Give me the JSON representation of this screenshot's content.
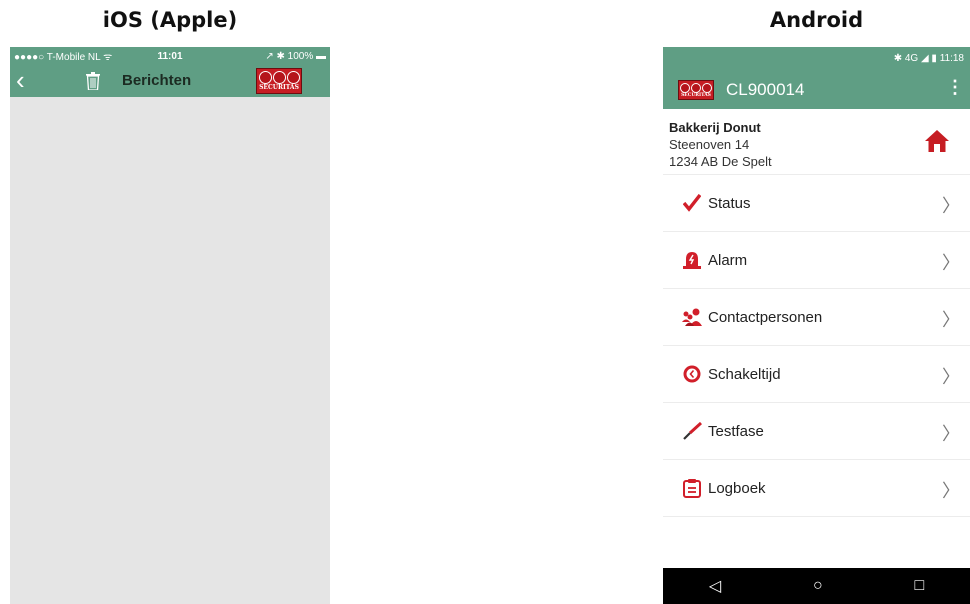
{
  "headings": {
    "ios": "iOS (Apple)",
    "android": "Android"
  },
  "ios": {
    "status": {
      "carrier": "●●●●○ T-Mobile NL ᯤ",
      "time": "11:01",
      "right": "↗ ✱ 100% ▬"
    },
    "nav": {
      "back": "‹",
      "title": "Berichten"
    },
    "logo_text": "SECURITAS"
  },
  "android": {
    "status": "✱ 4G ◢ ▮ 11:18",
    "toolbar": {
      "title": "CL900014",
      "menu": "⋮"
    },
    "logo_text": "SECURITAS",
    "address": {
      "name": "Bakkerij Donut",
      "street": "Steenoven 14",
      "city": "1234 AB De Spelt"
    },
    "menu": [
      {
        "label": "Status",
        "icon": "check-icon"
      },
      {
        "label": "Alarm",
        "icon": "alarm-icon"
      },
      {
        "label": "Contactpersonen",
        "icon": "contacts-icon"
      },
      {
        "label": "Schakeltijd",
        "icon": "clock-icon"
      },
      {
        "label": "Testfase",
        "icon": "test-icon"
      },
      {
        "label": "Logboek",
        "icon": "logbook-icon"
      }
    ],
    "chevron": "〉",
    "navbar": {
      "back": "◁",
      "home": "○",
      "recents": "□"
    }
  },
  "colors": {
    "header": "#5f9e84",
    "accent": "#c61d23",
    "ios_bg": "#e5e5e5"
  }
}
